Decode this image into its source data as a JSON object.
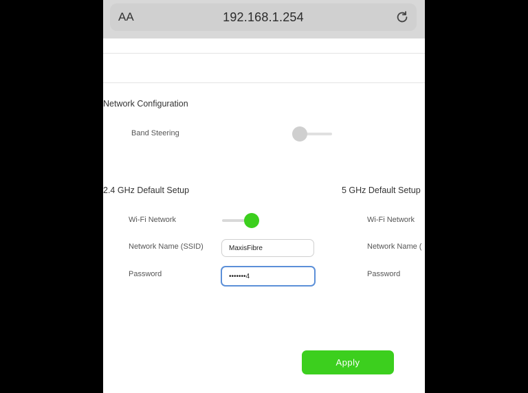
{
  "browser": {
    "text_size_label": "AA",
    "url": "192.168.1.254"
  },
  "network_configuration": {
    "title": "Network Configuration",
    "band_steering_label": "Band Steering",
    "band_steering_on": false
  },
  "setup_24": {
    "title": "2.4 GHz Default Setup",
    "wifi_network_label": "Wi-Fi Network",
    "wifi_network_on": true,
    "ssid_label": "Network Name (SSID)",
    "ssid_value": "MaxisFibre",
    "password_label": "Password",
    "password_value": "•••••••4"
  },
  "setup_5": {
    "title": "5 GHz Default Setup",
    "wifi_network_label": "Wi-Fi Network",
    "ssid_label": "Network Name (",
    "password_label": "Password"
  },
  "apply_label": "Apply",
  "colors": {
    "accent_green": "#3ccf1e",
    "focus_blue": "#5b8fd8"
  }
}
